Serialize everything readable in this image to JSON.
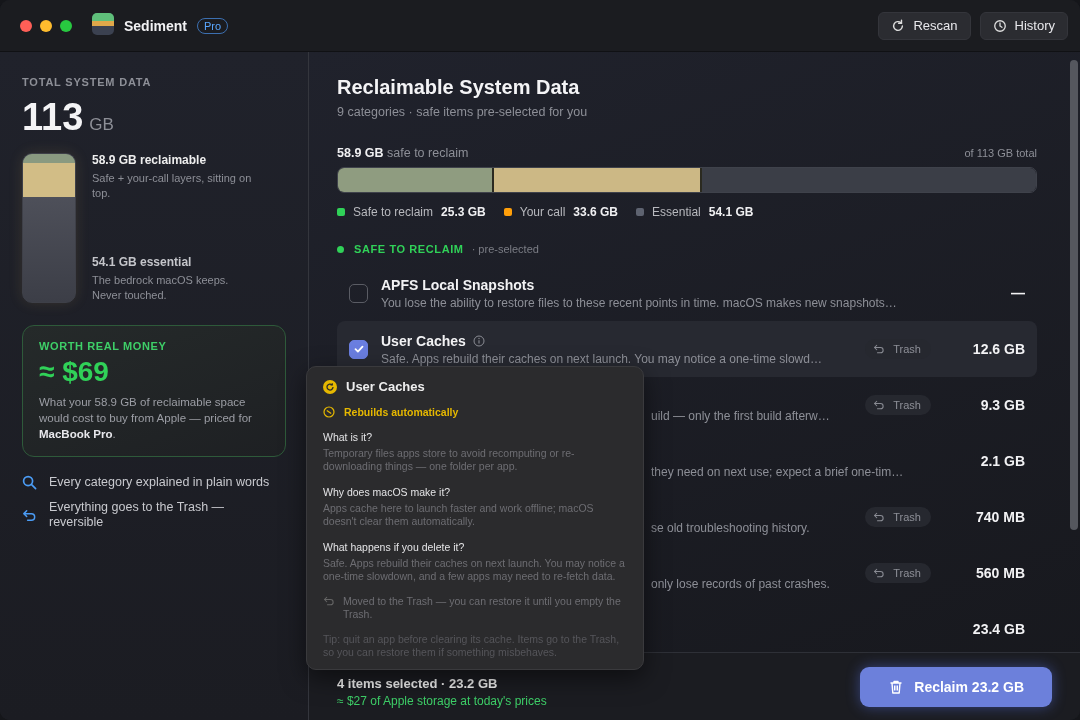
{
  "window": {
    "title": "Sediment",
    "badge": "Pro"
  },
  "toolbar": [
    {
      "kind": "rescan",
      "label": "Rescan"
    },
    {
      "kind": "history",
      "label": "History"
    }
  ],
  "sidebar": {
    "heading": "TOTAL SYSTEM DATA",
    "total": "113",
    "unit": "GB",
    "stack_legend": [
      {
        "title": "58.9 GB reclaimable",
        "text": "Safe + your-call layers, sitting on top."
      },
      {
        "title": "54.1 GB essential",
        "text": "The bedrock macOS keeps. Never touched."
      }
    ],
    "money_card": {
      "heading": "WORTH REAL MONEY",
      "amount": "≈ $69",
      "text": "What your 58.9 GB of reclaimable space would cost to buy from Apple — priced for **MacBook Pro**."
    },
    "features": [
      {
        "kind": "search",
        "text": "Every category explained in plain words"
      },
      {
        "kind": "undo",
        "text": "Everything goes to the Trash — reversible"
      }
    ]
  },
  "main": {
    "title": "Reclaimable System Data",
    "subtitle": "9 categories · safe items pre-selected for you",
    "summary": {
      "lead": "**58.9 GB** safe to reclaim",
      "total": "of 113 GB total"
    },
    "segments": [
      {
        "kind": "safe",
        "name": "Safe to reclaim",
        "value": "25.3 GB",
        "color": "#30d158",
        "level": 0.224
      },
      {
        "kind": "call",
        "name": "Your call",
        "value": "33.6 GB",
        "color": "#ff9f0a",
        "level": 0.297
      },
      {
        "kind": "essential",
        "name": "Essential",
        "value": "54.1 GB",
        "color": "#5e6370",
        "level": 0.479
      }
    ],
    "section": {
      "label": "SAFE TO RECLAIM",
      "note": "· pre-selected",
      "color": "#30d158"
    },
    "rows": [
      {
        "title": "APFS Local Snapshots",
        "description": "You lose the ability to restore files to these recent points in time. macOS makes new snapshots…",
        "checked": false,
        "selected": false,
        "info": false,
        "covered": false,
        "size": "—"
      },
      {
        "title": "User Caches",
        "description": "Safe. Apps rebuild their caches on next launch. You may notice a one-time slowd…",
        "checked": true,
        "selected": true,
        "info": true,
        "covered": false,
        "trash": "Trash",
        "size": "12.6 GB"
      },
      {
        "description": "uild — only the first build afterw…",
        "selected": false,
        "covered": true,
        "trash": "Trash",
        "size": "9.3 GB"
      },
      {
        "description": "they need on next use; expect a brief one-tim…",
        "selected": false,
        "covered": true,
        "size": "2.1 GB"
      },
      {
        "description": "se old troubleshooting history.",
        "selected": false,
        "covered": true,
        "trash": "Trash",
        "size": "740 MB"
      },
      {
        "description": "only lose records of past crashes.",
        "selected": false,
        "covered": true,
        "trash": "Trash",
        "size": "560 MB"
      },
      {
        "selected": false,
        "size": "23.4 GB"
      }
    ]
  },
  "popover": {
    "title": "User Caches",
    "tag": "Rebuilds automatically",
    "sections": [
      {
        "question": "What is it?",
        "answer": "Temporary files apps store to avoid recomputing or re-downloading things — one folder per app."
      },
      {
        "question": "Why does macOS make it?",
        "answer": "Apps cache here to launch faster and work offline; macOS doesn't clear them automatically."
      },
      {
        "question": "What happens if you delete it?",
        "answer": "Safe. Apps rebuild their caches on next launch. You may notice a one-time slowdown, and a few apps may need to re-fetch data."
      }
    ],
    "note": "Moved to the Trash — you can restore it until you empty the Trash.",
    "tip": "Tip: quit an app before clearing its cache. Items go to the Trash, so you can restore them if something misbehaves."
  },
  "footer": {
    "selection": "4 items selected · 23.2 GB",
    "value": "≈ $27 of Apple storage at today's prices",
    "button": "Reclaim 23.2 GB"
  }
}
